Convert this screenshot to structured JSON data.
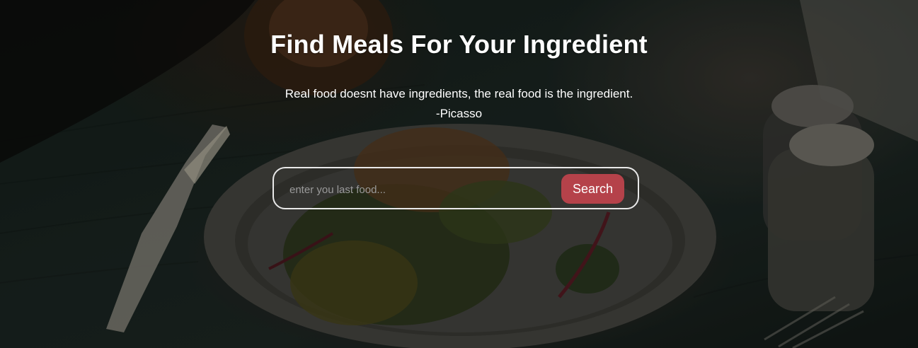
{
  "hero": {
    "title": "Find Meals For Your Ingredient",
    "quote_text": "Real food doesnt have ingredients, the real food is the ingredient.",
    "quote_author": "-Picasso"
  },
  "search": {
    "placeholder": "enter you last food...",
    "value": "",
    "button_label": "Search",
    "button_color": "#b5424a"
  }
}
